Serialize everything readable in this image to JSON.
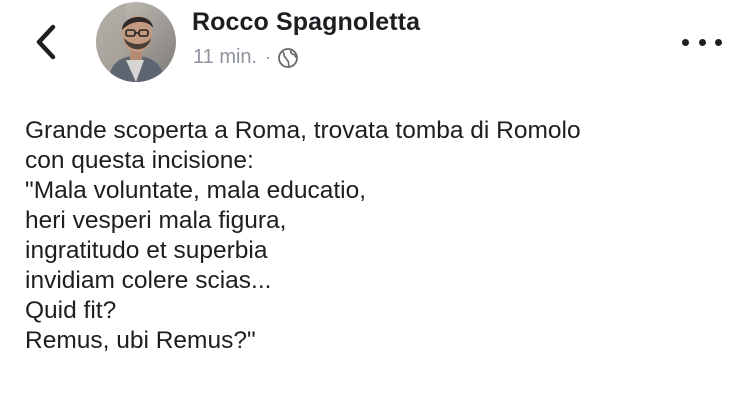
{
  "header": {
    "back_icon": "chevron-left-icon",
    "author_name": "Rocco Spagnoletta",
    "timestamp": "11 min.",
    "separator": "·",
    "privacy_icon": "globe-icon",
    "more_icon": "more-dots-icon"
  },
  "post": {
    "lines": [
      "Grande scoperta a Roma, trovata tomba di Romolo",
      "con questa incisione:",
      "\"Mala voluntate, mala educatio,",
      "heri vesperi mala figura,",
      "ingratitudo et superbia",
      "invidiam colere scias...",
      "Quid fit?",
      "Remus, ubi Remus?\""
    ]
  },
  "colors": {
    "text": "#1c1e21",
    "meta": "#8d949e",
    "background": "#ffffff"
  }
}
